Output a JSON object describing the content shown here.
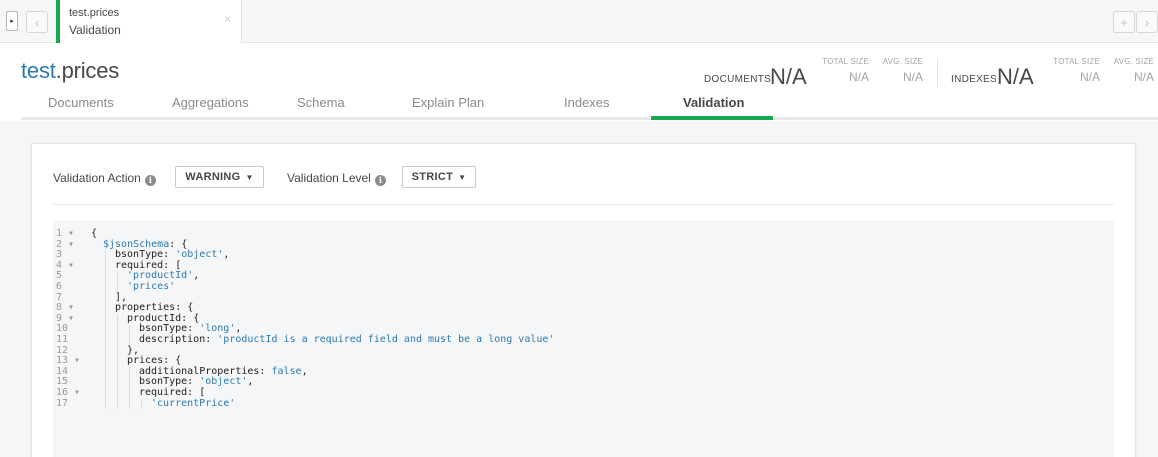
{
  "tabbar": {
    "namespace": "test.prices",
    "subtitle": "Validation",
    "close_glyph": "×",
    "add_glyph": "+",
    "prev_glyph": "‹",
    "next_glyph": "›",
    "sidebar_glyph": "▸"
  },
  "collection": {
    "db": "test",
    "name": ".prices",
    "documents_label": "Documents",
    "documents_value": "N/A",
    "doc_total_size_label": "TOTAL SIZE",
    "doc_total_size_value": "N/A",
    "doc_avg_size_label": "AVG. SIZE",
    "doc_avg_size_value": "N/A",
    "indexes_label": "Indexes",
    "indexes_value": "N/A",
    "idx_total_size_label": "TOTAL SIZE",
    "idx_total_size_value": "N/A",
    "idx_avg_size_label": "AVG. SIZE",
    "idx_avg_size_value": "N/A"
  },
  "subtabs": [
    "Documents",
    "Aggregations",
    "Schema",
    "Explain Plan",
    "Indexes",
    "Validation"
  ],
  "validation": {
    "action_label": "Validation Action",
    "action_value": "WARNING",
    "level_label": "Validation Level",
    "level_value": "STRICT"
  },
  "colors": {
    "accent_green": "#13aa52",
    "link_blue": "#2d7ab0"
  },
  "editor_lines": [
    {
      "n": "1",
      "fold": true,
      "indent": 0,
      "parts": [
        [
          "c",
          "{"
        ]
      ]
    },
    {
      "n": "2",
      "fold": true,
      "indent": 1,
      "parts": [
        [
          "k",
          "$jsonSchema"
        ],
        [
          "c",
          ": {"
        ]
      ]
    },
    {
      "n": "3",
      "fold": false,
      "indent": 2,
      "parts": [
        [
          "c",
          "bsonType: "
        ],
        [
          "s",
          "'object'"
        ],
        [
          "c",
          ","
        ]
      ]
    },
    {
      "n": "4",
      "fold": true,
      "indent": 2,
      "parts": [
        [
          "c",
          "required: ["
        ]
      ]
    },
    {
      "n": "5",
      "fold": false,
      "indent": 3,
      "parts": [
        [
          "s",
          "'productId'"
        ],
        [
          "c",
          ","
        ]
      ]
    },
    {
      "n": "6",
      "fold": false,
      "indent": 3,
      "parts": [
        [
          "s",
          "'prices'"
        ]
      ]
    },
    {
      "n": "7",
      "fold": false,
      "indent": 2,
      "parts": [
        [
          "c",
          "],"
        ]
      ]
    },
    {
      "n": "8",
      "fold": true,
      "indent": 2,
      "parts": [
        [
          "c",
          "properties: {"
        ]
      ]
    },
    {
      "n": "9",
      "fold": true,
      "indent": 3,
      "parts": [
        [
          "c",
          "productId: {"
        ]
      ]
    },
    {
      "n": "10",
      "fold": false,
      "indent": 4,
      "parts": [
        [
          "c",
          "bsonType: "
        ],
        [
          "s",
          "'long'"
        ],
        [
          "c",
          ","
        ]
      ]
    },
    {
      "n": "11",
      "fold": false,
      "indent": 4,
      "parts": [
        [
          "c",
          "description: "
        ],
        [
          "s",
          "'productId is a required field and must be a long value'"
        ]
      ]
    },
    {
      "n": "12",
      "fold": false,
      "indent": 3,
      "parts": [
        [
          "c",
          "},"
        ]
      ]
    },
    {
      "n": "13",
      "fold": true,
      "indent": 3,
      "parts": [
        [
          "c",
          "prices: {"
        ]
      ]
    },
    {
      "n": "14",
      "fold": false,
      "indent": 4,
      "parts": [
        [
          "c",
          "additionalProperties: "
        ],
        [
          "b",
          "false"
        ],
        [
          "c",
          ","
        ]
      ]
    },
    {
      "n": "15",
      "fold": false,
      "indent": 4,
      "parts": [
        [
          "c",
          "bsonType: "
        ],
        [
          "s",
          "'object'"
        ],
        [
          "c",
          ","
        ]
      ]
    },
    {
      "n": "16",
      "fold": true,
      "indent": 4,
      "parts": [
        [
          "c",
          "required: ["
        ]
      ]
    },
    {
      "n": "17",
      "fold": false,
      "indent": 5,
      "parts": [
        [
          "s",
          "'currentPrice'"
        ]
      ]
    }
  ]
}
